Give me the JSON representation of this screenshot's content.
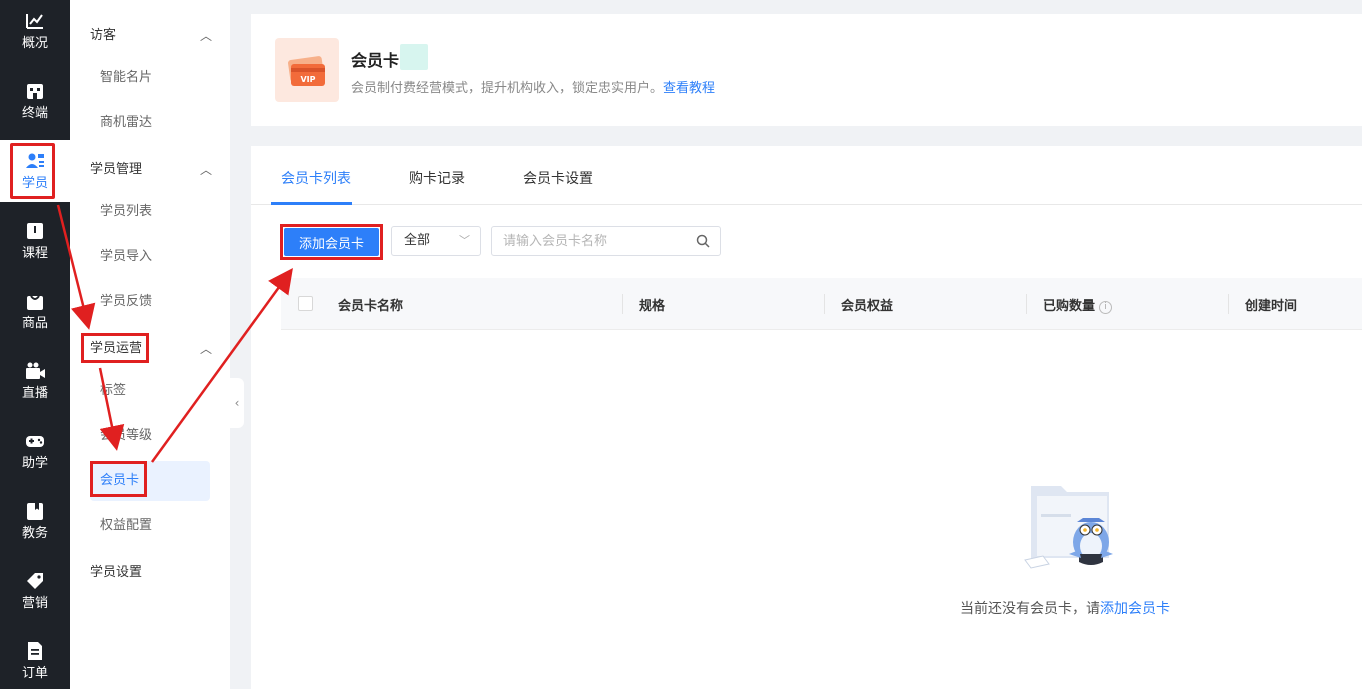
{
  "rail": {
    "items": [
      {
        "label": "概况",
        "icon": "chart-icon"
      },
      {
        "label": "终端",
        "icon": "terminal-icon"
      },
      {
        "label": "学员",
        "icon": "students-icon"
      },
      {
        "label": "课程",
        "icon": "book-icon"
      },
      {
        "label": "商品",
        "icon": "bag-icon"
      },
      {
        "label": "直播",
        "icon": "camera-icon"
      },
      {
        "label": "助学",
        "icon": "gamepad-icon"
      },
      {
        "label": "教务",
        "icon": "notebook-icon"
      },
      {
        "label": "营销",
        "icon": "tag-icon"
      },
      {
        "label": "订单",
        "icon": "document-icon"
      }
    ],
    "active": "学员"
  },
  "subnav": {
    "groups": [
      {
        "label": "访客",
        "items": [
          "智能名片",
          "商机雷达"
        ]
      },
      {
        "label": "学员管理",
        "items": [
          "学员列表",
          "学员导入",
          "学员反馈"
        ]
      },
      {
        "label": "学员运营",
        "items": [
          "标签",
          "会员等级",
          "会员卡",
          "权益配置"
        ]
      },
      {
        "label": "学员设置",
        "items": []
      }
    ],
    "active_item": "会员卡"
  },
  "header": {
    "title": "会员卡",
    "description": "会员制付费经营模式，提升机构收入，锁定忠实用户。",
    "link": "查看教程",
    "icon": "vip-card-icon"
  },
  "tabs": [
    "会员卡列表",
    "购卡记录",
    "会员卡设置"
  ],
  "active_tab": "会员卡列表",
  "toolbar": {
    "add_label": "添加会员卡",
    "filter_value": "全部",
    "search_placeholder": "请输入会员卡名称"
  },
  "table": {
    "columns": [
      "会员卡名称",
      "规格",
      "会员权益",
      "已购数量",
      "创建时间"
    ],
    "rows": []
  },
  "empty": {
    "text": "当前还没有会员卡，请",
    "link": "添加会员卡"
  },
  "colors": {
    "accent": "#2d7ff9",
    "rail_bg": "#1e2228",
    "annotation": "#e02020"
  }
}
